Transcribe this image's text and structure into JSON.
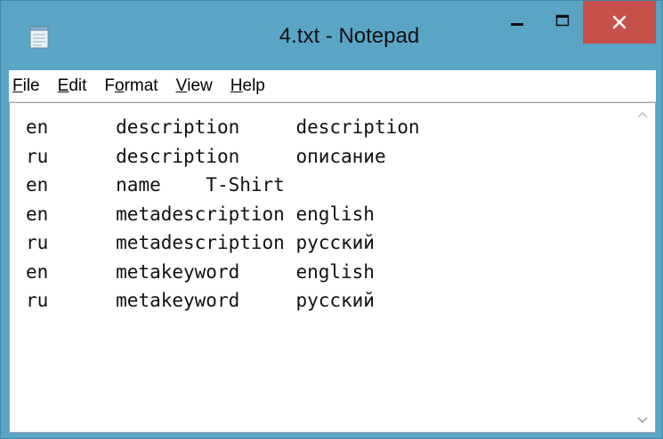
{
  "window": {
    "title": "4.txt - Notepad"
  },
  "menu": [
    {
      "key": "F",
      "rest": "ile"
    },
    {
      "key": "E",
      "rest": "dit"
    },
    {
      "pre": "F",
      "key": "o",
      "rest": "rmat"
    },
    {
      "key": "V",
      "rest": "iew"
    },
    {
      "key": "H",
      "rest": "elp"
    }
  ],
  "editor": {
    "content": "en\tdescription\tdescription\nru\tdescription\tописание\nen\tname\tT-Shirt\nen\tmetadescription\tenglish\nru\tmetadescription\tрусский\nen\tmetakeyword\tenglish\nru\tmetakeyword\tрусский"
  },
  "icons": {
    "app": "notepad-icon",
    "minimize": "minimize-icon",
    "maximize": "maximize-icon",
    "close": "close-icon",
    "scroll_up": "chevron-up-icon",
    "scroll_down": "chevron-down-icon"
  },
  "colors": {
    "frame": "#5aa5c6",
    "close": "#c7504a"
  }
}
